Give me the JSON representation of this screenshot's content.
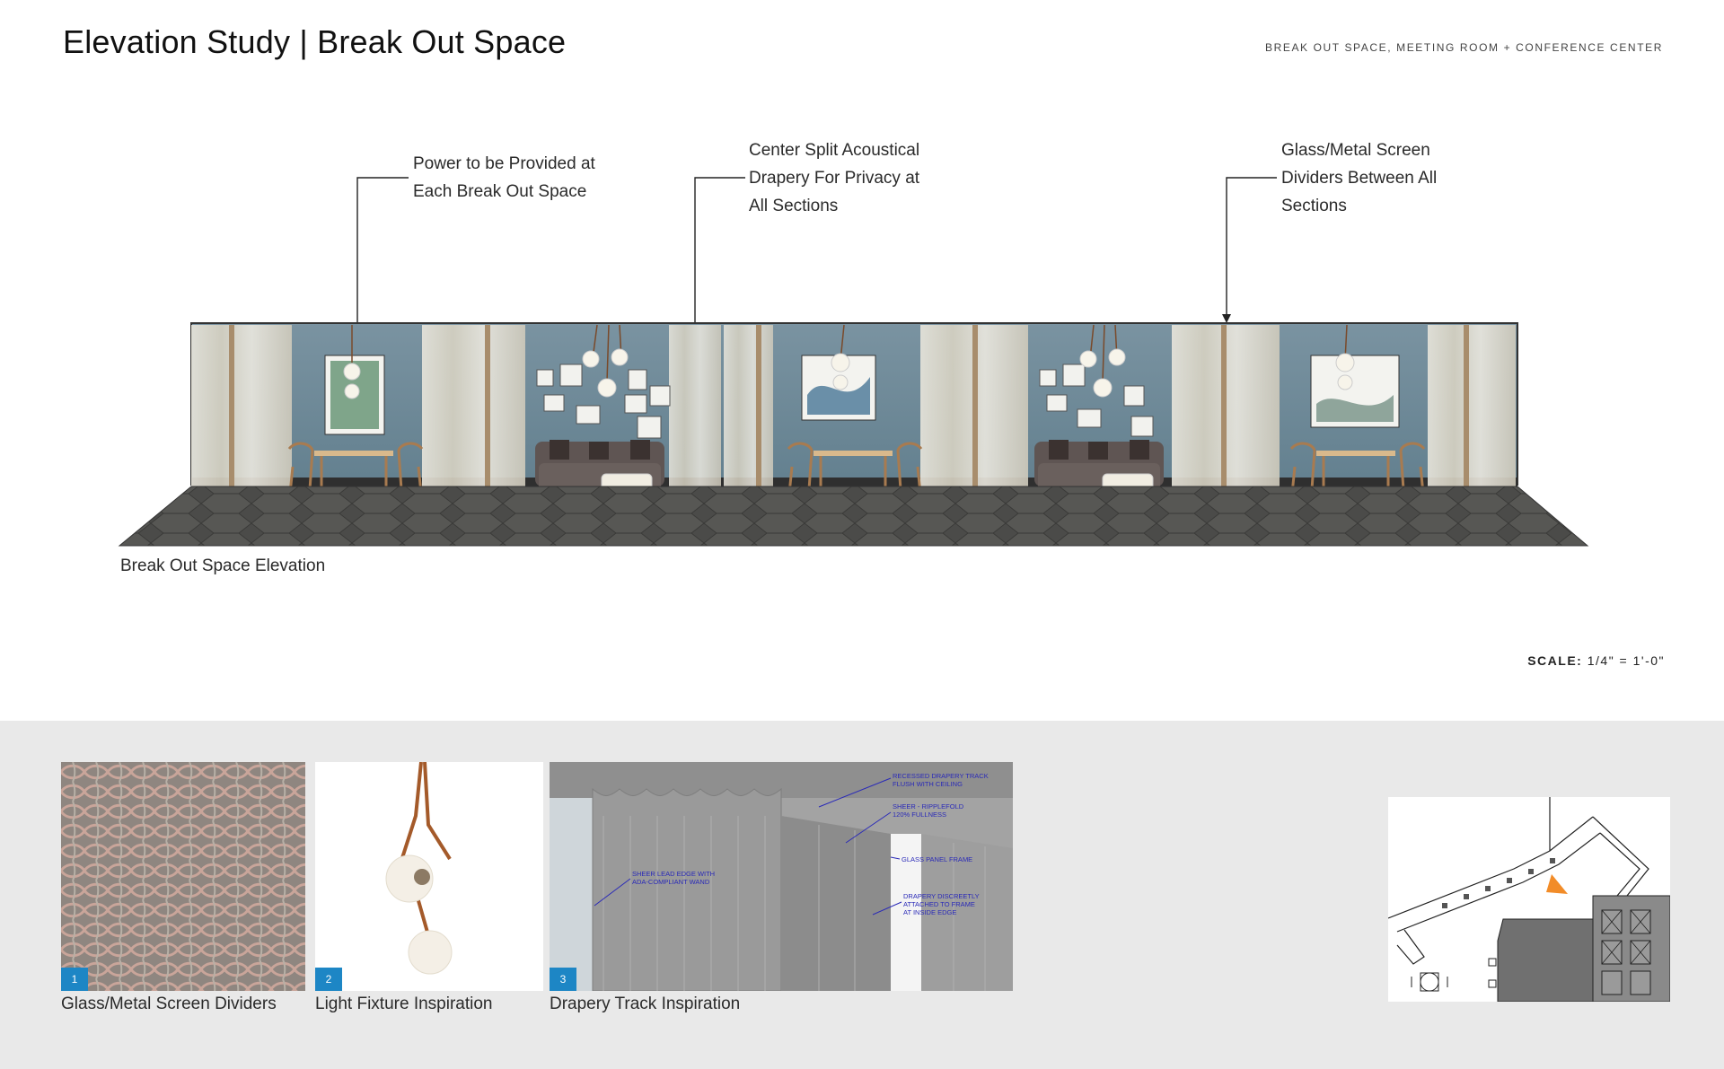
{
  "header": {
    "title": "Elevation Study | Break Out Space",
    "subtitle": "BREAK OUT SPACE, MEETING ROOM + CONFERENCE CENTER"
  },
  "callouts": {
    "power": [
      "Power to be Provided at",
      "Each Break Out Space"
    ],
    "drapery": [
      "Center Split Acoustical",
      "Drapery For Privacy at",
      "All Sections"
    ],
    "screen": [
      "Glass/Metal Screen",
      "Dividers Between All",
      "Sections"
    ]
  },
  "elevation": {
    "caption": "Break Out Space Elevation"
  },
  "scale": {
    "label": "SCALE:",
    "value": "1/4\" = 1'-0\""
  },
  "inspiration": [
    {
      "number": "1",
      "caption": "Glass/Metal Screen Dividers"
    },
    {
      "number": "2",
      "caption": "Light Fixture Inspiration"
    },
    {
      "number": "3",
      "caption": "Drapery Track Inspiration"
    }
  ],
  "drapery_notes": {
    "note1": [
      "RECESSED DRAPERY TRACK",
      "FLUSH WITH CEILING"
    ],
    "note2": [
      "SHEER - RIPPLEFOLD",
      "120% FULLNESS"
    ],
    "note3": [
      "GLASS PANEL FRAME"
    ],
    "note4": [
      "SHEER LEAD EDGE WITH",
      "ADA-COMPLIANT WAND"
    ],
    "note5": [
      "DRAPERY DISCREETLY",
      "ATTACHED TO FRAME",
      "AT INSIDE EDGE"
    ]
  },
  "colors": {
    "accent_blue": "#1d86c5",
    "wall_blue": "#6f8a99",
    "floor": "#4a4a48",
    "band": "#e9e9e9",
    "keyplan_marker": "#f28c28"
  }
}
